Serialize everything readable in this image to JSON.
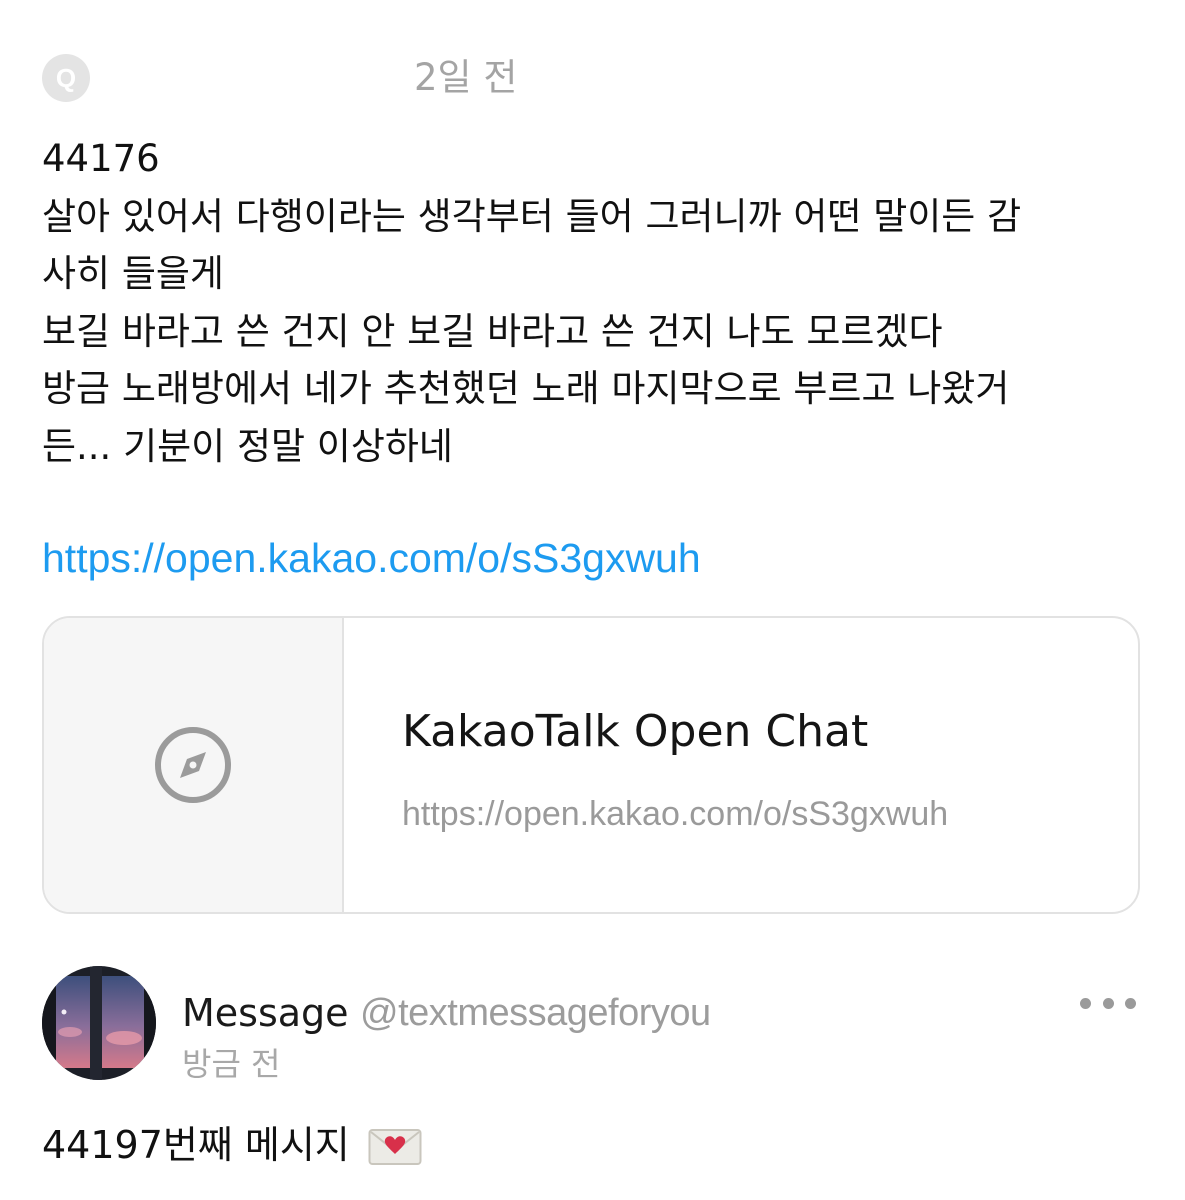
{
  "post1": {
    "avatar_letter": "Q",
    "time": "2일 전",
    "lines": [
      "44176",
      "살아 있어서 다행이라는 생각부터 들어 그러니까 어떤 말이든 감",
      "사히 들을게",
      "보길 바라고 쓴 건지 안 보길 바라고 쓴 건지 나도 모르겠다",
      "방금 노래방에서 네가 추천했던 노래 마지막으로 부르고 나왔거",
      "든... 기분이 정말 이상하네"
    ],
    "link": "https://open.kakao.com/o/sS3gxwuh",
    "preview": {
      "icon": "compass-icon",
      "title": "KakaoTalk Open Chat",
      "url": "https://open.kakao.com/o/sS3gxwuh"
    }
  },
  "post2": {
    "name": "Message",
    "handle": "@textmessageforyou",
    "time": "방금 전",
    "more_icon": "more-horizontal-icon",
    "message": "44197번째 메시지",
    "message_icon": "love-letter-icon"
  },
  "colors": {
    "link": "#1d9bf0",
    "muted": "#a4a4a4",
    "card_border": "#e2e2e2",
    "heart": "#d8304a"
  }
}
